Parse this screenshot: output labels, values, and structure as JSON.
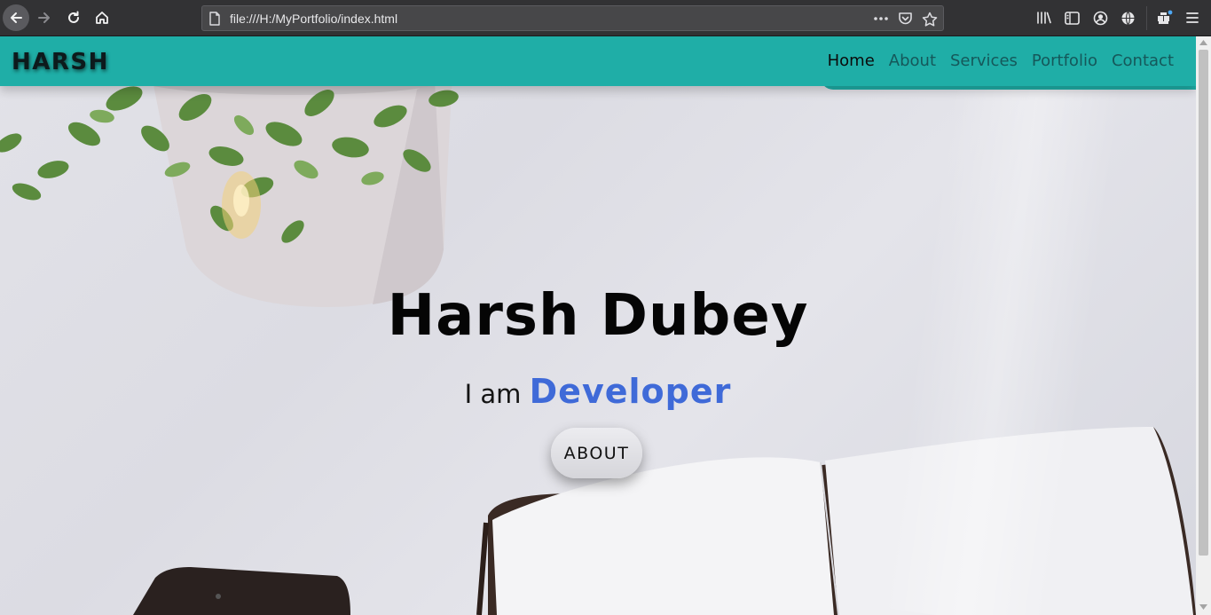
{
  "browser": {
    "url": "file:///H:/MyPortfolio/index.html",
    "icons": {
      "back": "back-arrow-icon",
      "forward": "forward-arrow-icon",
      "reload": "reload-icon",
      "home": "home-icon",
      "page": "page-icon",
      "more": "more-dots-icon",
      "pocket": "pocket-icon",
      "bookmark": "star-icon",
      "library": "library-icon",
      "sidebar": "sidebar-icon",
      "account": "account-icon",
      "globe": "globe-icon",
      "extension": "extension-icon",
      "menu": "hamburger-menu-icon"
    }
  },
  "site": {
    "logo": "HARSH",
    "nav": [
      {
        "label": "Home",
        "active": true
      },
      {
        "label": "About",
        "active": false
      },
      {
        "label": "Services",
        "active": false
      },
      {
        "label": "Portfolio",
        "active": false
      },
      {
        "label": "Contact",
        "active": false
      }
    ],
    "colors": {
      "navbar": "#1faea7",
      "nav_link": "#15585a",
      "role_text": "#3f6ad8"
    }
  },
  "hero": {
    "title": "Harsh Dubey",
    "intro": "I am",
    "role": "Developer",
    "button_label": "ABOUT"
  }
}
